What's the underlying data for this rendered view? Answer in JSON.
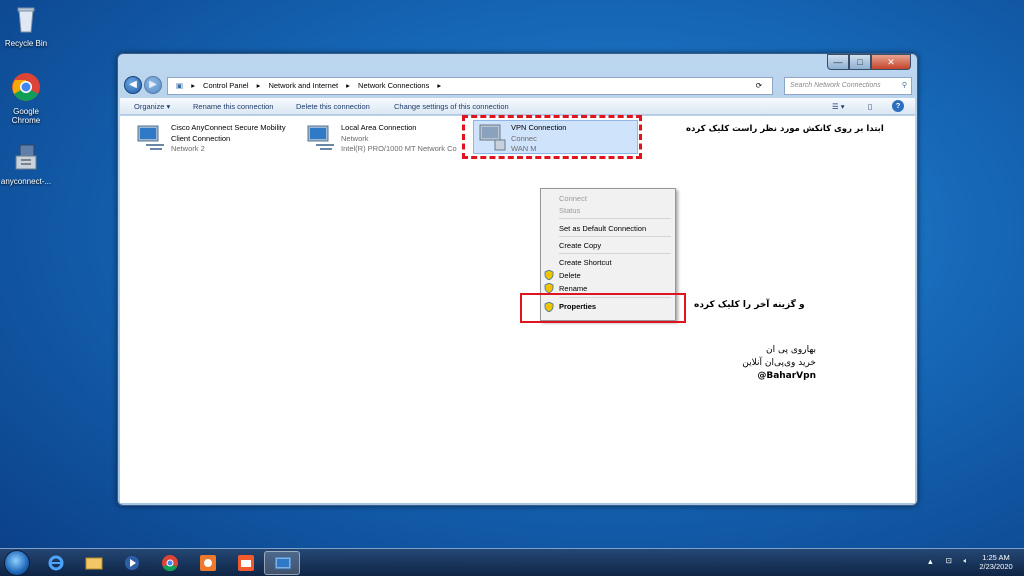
{
  "desktop": {
    "icons": [
      {
        "label": "Recycle Bin",
        "icon": "recycle-bin-icon"
      },
      {
        "label": "Google Chrome",
        "icon": "chrome-icon"
      },
      {
        "label": "anyconnect-...",
        "icon": "installer-icon"
      }
    ]
  },
  "window": {
    "buttons": {
      "minimize": "—",
      "maximize": "□",
      "close": "✕"
    },
    "breadcrumb": [
      "Control Panel",
      "Network and Internet",
      "Network Connections"
    ],
    "search_placeholder": "Search Network Connections",
    "toolbar": {
      "organize": "Organize ▾",
      "rename": "Rename this connection",
      "delete": "Delete this connection",
      "change": "Change settings of this connection"
    },
    "connections": [
      {
        "name": "Cisco AnyConnect Secure Mobility",
        "name2": "Client Connection",
        "status": "Network  2"
      },
      {
        "name": "Local Area Connection",
        "status": "Network",
        "device": "Intel(R) PRO/1000 MT Network Co"
      },
      {
        "name": "VPN Connection",
        "status": "Connec",
        "device": "WAN M"
      }
    ]
  },
  "context_menu": {
    "items": [
      "Connect",
      "Status",
      "Set as Default Connection",
      "Create Copy",
      "Create Shortcut",
      "Delete",
      "Rename",
      "Properties"
    ]
  },
  "annotations": {
    "step1": "ابتدا بر روی کانکش مورد نظر راست کلیک کرده",
    "step2": "و گزینه آخر را کلیک کرده",
    "watermark_line1": "بهاروی پی ان",
    "watermark_line2": "خرید وی‌پی‌ان آنلاین",
    "watermark_handle": "@BaharVpn"
  },
  "taskbar": {
    "time": "1:25 AM",
    "date": "2/23/2020"
  }
}
